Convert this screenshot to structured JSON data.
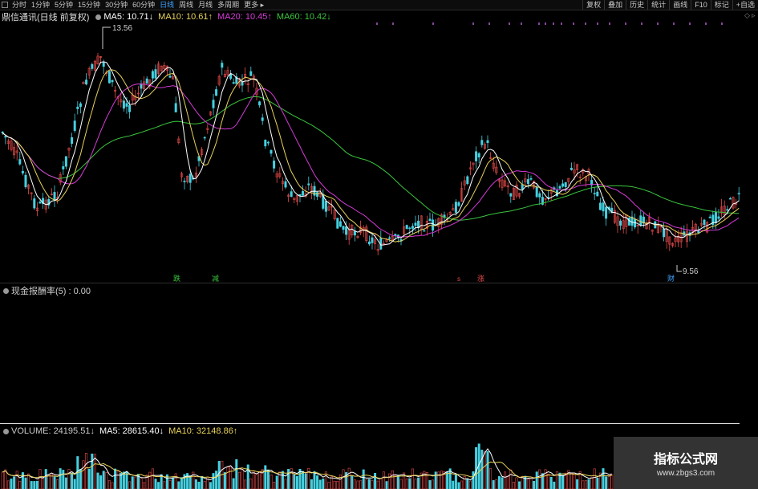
{
  "toolbar": {
    "periods": [
      "分时",
      "1分钟",
      "5分钟",
      "15分钟",
      "30分钟",
      "60分钟",
      "日线",
      "周线",
      "月线",
      "多周期",
      "更多"
    ],
    "active": "日线",
    "right_buttons": [
      "复权",
      "叠加",
      "历史",
      "统计",
      "画线",
      "F10",
      "标记",
      "+自选"
    ]
  },
  "main_legend": {
    "title": "鼎信通讯(日线 前复权)",
    "ma5": "MA5: 10.71↓",
    "ma10": "MA10: 10.61↑",
    "ma20": "MA20: 10.45↑",
    "ma60": "MA60: 10.42↓",
    "ma5_color": "#ffffff",
    "ma10_color": "#e8d25a",
    "ma20_color": "#d63bd6",
    "ma60_color": "#39c43c"
  },
  "annotations": {
    "high_label": "13.56",
    "low_label": "9.56",
    "events": [
      "跌",
      "减",
      "涨",
      "财"
    ]
  },
  "indicator_panel": {
    "label": "现金报酬率(5) : 0.00"
  },
  "volume_legend": {
    "volume": "VOLUME: 24195.51↓",
    "ma5": "MA5: 28615.40↓",
    "ma10": "MA10: 32148.86↑"
  },
  "watermark": {
    "title": "指标公式网",
    "url": "www.zbgs3.com"
  },
  "colors": {
    "up": "#e84a4a",
    "down": "#45d0e0",
    "accent": "#3ea3ff"
  }
}
